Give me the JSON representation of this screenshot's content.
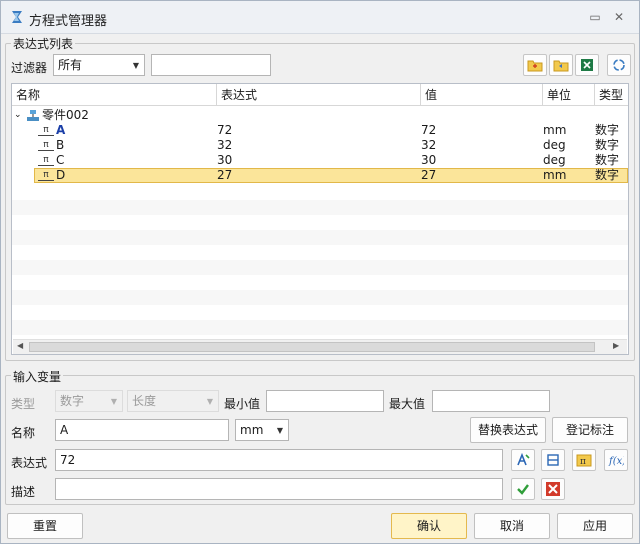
{
  "window": {
    "title": "方程式管理器",
    "restore_glyph": "▭",
    "close_glyph": "✕"
  },
  "list_group": {
    "title": "表达式列表",
    "filter_label": "过滤器",
    "filter_value": "所有",
    "filter_text": ""
  },
  "table": {
    "columns": [
      "名称",
      "表达式",
      "值",
      "单位",
      "类型"
    ],
    "root": {
      "name": "零件002"
    },
    "rows": [
      {
        "name": "A",
        "expr": "72",
        "value": "72",
        "unit": "mm",
        "type": "数字"
      },
      {
        "name": "B",
        "expr": "32",
        "value": "32",
        "unit": "deg",
        "type": "数字"
      },
      {
        "name": "C",
        "expr": "30",
        "value": "30",
        "unit": "deg",
        "type": "数字"
      },
      {
        "name": "D",
        "expr": "27",
        "value": "27",
        "unit": "mm",
        "type": "数字"
      }
    ],
    "param_glyph": "π"
  },
  "input_group": {
    "title": "输入变量",
    "type_label": "类型",
    "type_value": "数字",
    "subtype_value": "长度",
    "min_label": "最小值",
    "min_value": "",
    "max_label": "最大值",
    "max_value": "",
    "name_label": "名称",
    "name_value": "A",
    "unit_value": "mm",
    "replace_button": "替换表达式",
    "register_button": "登记标注",
    "expr_label": "表达式",
    "expr_value": "72",
    "desc_label": "描述",
    "desc_value": ""
  },
  "footer": {
    "reset": "重置",
    "ok": "确认",
    "cancel": "取消",
    "apply": "应用"
  },
  "colors": {
    "selected_row": "#fbe59a",
    "primary_button": "#fff4c8",
    "accept_green": "#2f9e3a",
    "reject_red": "#d23a2a"
  }
}
